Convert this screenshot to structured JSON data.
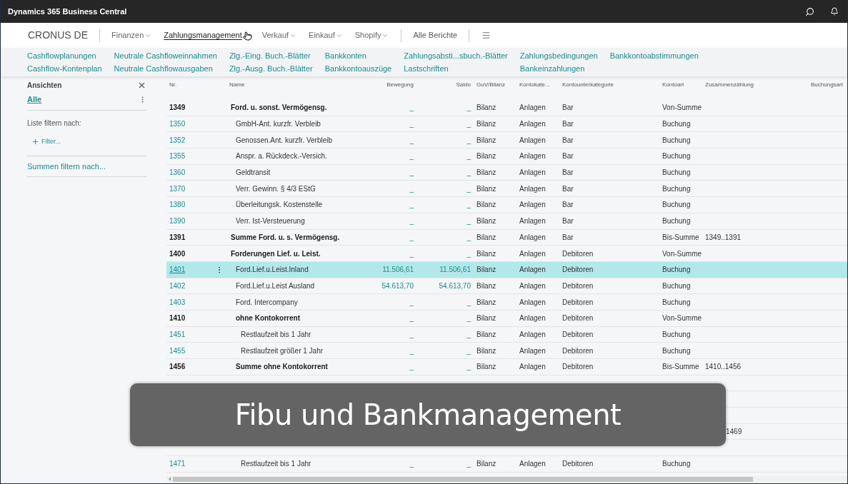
{
  "app_bar": {
    "title": "Dynamics 365 Business Central"
  },
  "nav": {
    "company": "CRONUS DE",
    "items": [
      {
        "label": "Finanzen",
        "selected": false
      },
      {
        "label": "Zahlungsmanagement",
        "selected": true
      },
      {
        "label": "Verkauf",
        "selected": false
      },
      {
        "label": "Einkauf",
        "selected": false
      },
      {
        "label": "Shopify",
        "selected": false
      }
    ],
    "reports": "Alle Berichte"
  },
  "submenu": [
    [
      "Cashflowplanungen",
      "Cashflow-Kontenplan"
    ],
    [
      "Neutrale Cashfloweinnahmen",
      "Neutrale Cashflowausgaben"
    ],
    [
      "Zlg.-Eing. Buch.-Blätter",
      "Zlg.-Ausg. Buch.-Blätter"
    ],
    [
      "Bankkonten",
      "Bankkontoauszüge"
    ],
    [
      "Zahlungsabsti...sbuch.-Blätter",
      "Lastschriften"
    ],
    [
      "Zahlungsbedingungen",
      "Bankeinzahlungen"
    ],
    [
      "Bankkontoabstimmungen"
    ]
  ],
  "views_pane": {
    "title": "Ansichten",
    "views": [
      {
        "label": "Alle",
        "selected": true
      }
    ],
    "filter_heading": "Liste filtern nach:",
    "filter_button": "Filter...",
    "totals_link": "Summen filtern nach..."
  },
  "table": {
    "columns": [
      "Nr.",
      "Name",
      "Bewegung",
      "Saldo",
      "GuV/Bilanz",
      "Kontokate...",
      "Kontounterkategorie",
      "Kontoart",
      "Zusammenzählung",
      "Buchungsart"
    ],
    "rows": [
      {
        "kind": "account",
        "nr": "1349",
        "name": "Ford. u. sonst. Vermögensg.",
        "bold": true,
        "selected": false,
        "bewegung": "_",
        "saldo": "_",
        "guv": "Bilanz",
        "kat": "Anlagen",
        "unterkat": "Bar",
        "kontoart": "Von-Summe",
        "children": [
          {
            "kind": "account",
            "nr": "1350",
            "name": "GmbH-Ant. kurzfr. Verbleib",
            "bold": false,
            "selected": false,
            "bewegung": "_",
            "saldo": "_",
            "guv": "Bilanz",
            "kat": "Anlagen",
            "unterkat": "Bar",
            "kontoart": "Buchung"
          },
          {
            "kind": "account",
            "nr": "1352",
            "name": "Genossen.Ant. kurzfr. Verbleib",
            "bold": false,
            "selected": false,
            "bewegung": "_",
            "saldo": "_",
            "guv": "Bilanz",
            "kat": "Anlagen",
            "unterkat": "Bar",
            "kontoart": "Buchung"
          },
          {
            "kind": "account",
            "nr": "1355",
            "name": "Anspr. a. Rückdeck.-Versich.",
            "bold": false,
            "selected": false,
            "bewegung": "_",
            "saldo": "_",
            "guv": "Bilanz",
            "kat": "Anlagen",
            "unterkat": "Bar",
            "kontoart": "Buchung"
          },
          {
            "kind": "account",
            "nr": "1360",
            "name": "Geldtransit",
            "bold": false,
            "selected": false,
            "bewegung": "_",
            "saldo": "_",
            "guv": "Bilanz",
            "kat": "Anlagen",
            "unterkat": "Bar",
            "kontoart": "Buchung"
          },
          {
            "kind": "account",
            "nr": "1370",
            "name": "Verr. Gewinn. § 4/3 EStG",
            "bold": false,
            "selected": false,
            "bewegung": "_",
            "saldo": "_",
            "guv": "Bilanz",
            "kat": "Anlagen",
            "unterkat": "Bar",
            "kontoart": "Buchung"
          },
          {
            "kind": "account",
            "nr": "1380",
            "name": "Überleitungsk. Kostenstelle",
            "bold": false,
            "selected": false,
            "bewegung": "_",
            "saldo": "_",
            "guv": "Bilanz",
            "kat": "Anlagen",
            "unterkat": "Bar",
            "kontoart": "Buchung"
          },
          {
            "kind": "account",
            "nr": "1390",
            "name": "Verr. Ist-Versteuerung",
            "bold": false,
            "selected": false,
            "bewegung": "_",
            "saldo": "_",
            "guv": "Bilanz",
            "kat": "Anlagen",
            "unterkat": "Bar",
            "kontoart": "Buchung"
          }
        ]
      },
      {
        "kind": "account",
        "nr": "1391",
        "name": "Summe Ford. u. s. Vermögensg.",
        "bold": true,
        "selected": false,
        "bewegung": "_",
        "saldo": "_",
        "guv": "Bilanz",
        "kat": "Anlagen",
        "unterkat": "Bar",
        "kontoart": "Bis-Summe",
        "zusammen": "1349..1391"
      },
      {
        "kind": "account",
        "nr": "1400",
        "name": "Forderungen Lief. u. Leist.",
        "bold": true,
        "selected": false,
        "bewegung": "_",
        "saldo": "_",
        "guv": "Bilanz",
        "kat": "Anlagen",
        "unterkat": "Debitoren",
        "kontoart": "Von-Summe",
        "children": [
          {
            "kind": "account",
            "nr": "1401",
            "name": "Ford.Lief.u.Leist.Inland",
            "bold": false,
            "selected": true,
            "bewegung": "11.506,61",
            "saldo": "11.506,61",
            "guv": "Bilanz",
            "kat": "Anlagen",
            "unterkat": "Debitoren",
            "kontoart": "Buchung"
          },
          {
            "kind": "account",
            "nr": "1402",
            "name": "Ford.Lief.u.Leist Ausland",
            "bold": false,
            "selected": false,
            "bewegung": "54.613,70",
            "saldo": "54.613,70",
            "guv": "Bilanz",
            "kat": "Anlagen",
            "unterkat": "Debitoren",
            "kontoart": "Buchung"
          },
          {
            "kind": "account",
            "nr": "1403",
            "name": "Ford. Intercompany",
            "bold": false,
            "selected": false,
            "bewegung": "_",
            "saldo": "_",
            "guv": "Bilanz",
            "kat": "Anlagen",
            "unterkat": "Debitoren",
            "kontoart": "Buchung"
          },
          {
            "kind": "account",
            "nr": "1410",
            "name": "ohne Kontokorrent",
            "bold": true,
            "selected": false,
            "bewegung": "_",
            "saldo": "_",
            "guv": "Bilanz",
            "kat": "Anlagen",
            "unterkat": "Debitoren",
            "kontoart": "Von-Summe",
            "children": [
              {
                "kind": "account",
                "nr": "1451",
                "name": "Restlaufzeit bis 1 Jahr",
                "bold": false,
                "selected": false,
                "bewegung": "_",
                "saldo": "_",
                "guv": "Bilanz",
                "kat": "Anlagen",
                "unterkat": "Debitoren",
                "kontoart": "Buchung"
              },
              {
                "kind": "account",
                "nr": "1455",
                "name": "Restlaufzeit größer 1 Jahr",
                "bold": false,
                "selected": false,
                "bewegung": "_",
                "saldo": "_",
                "guv": "Bilanz",
                "kat": "Anlagen",
                "unterkat": "Debitoren",
                "kontoart": "Buchung"
              }
            ]
          },
          {
            "kind": "account",
            "nr": "1456",
            "name": "Summe ohne Kontokorrent",
            "bold": true,
            "selected": false,
            "bewegung": "_",
            "saldo": "_",
            "guv": "Bilanz",
            "kat": "Anlagen",
            "unterkat": "Debitoren",
            "kontoart": "Bis-Summe",
            "zusammen": "1410..1456"
          },
          {
            "kind": "covered"
          },
          {
            "kind": "covered"
          },
          {
            "kind": "covered"
          },
          {
            "kind": "covered",
            "zusammen": "1469"
          },
          {
            "kind": "covered",
            "children": [
              {
                "kind": "account",
                "nr": "1471",
                "name": "Restlaufzeit bis 1 Jahr",
                "bold": false,
                "selected": false,
                "bewegung": "_",
                "saldo": "_",
                "guv": "Bilanz",
                "kat": "Anlagen",
                "unterkat": "Debitoren",
                "kontoart": "Buchung"
              }
            ]
          }
        ]
      }
    ]
  },
  "caption": "Fibu und Bankmanagement"
}
